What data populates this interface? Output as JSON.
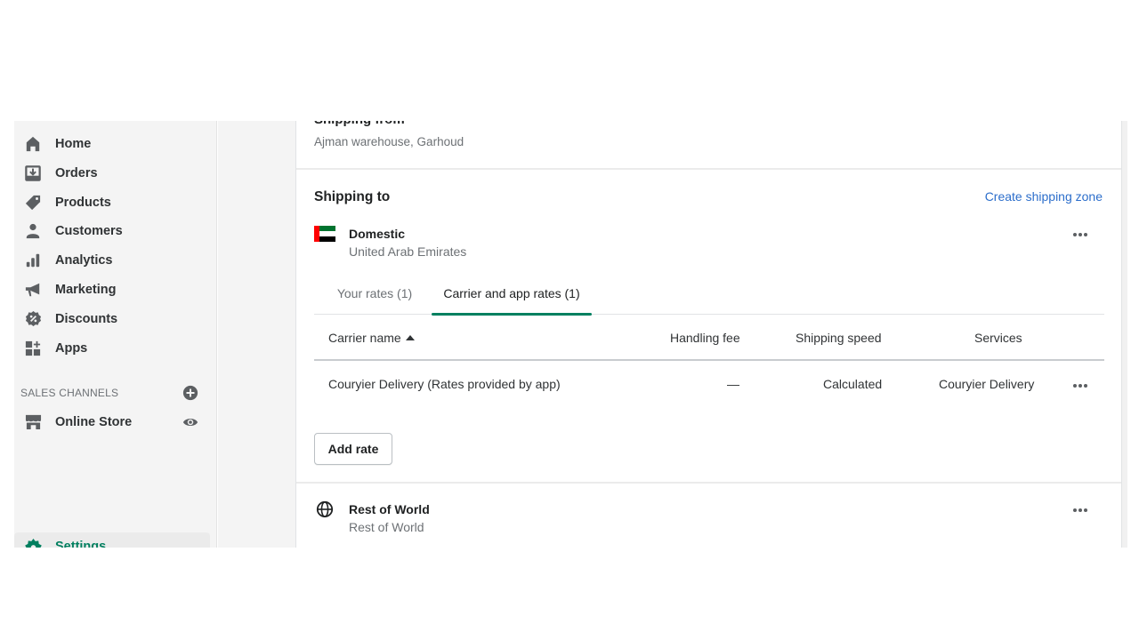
{
  "sidebar": {
    "items": [
      {
        "label": "Home",
        "icon": "home-icon"
      },
      {
        "label": "Orders",
        "icon": "orders-icon"
      },
      {
        "label": "Products",
        "icon": "tag-icon"
      },
      {
        "label": "Customers",
        "icon": "person-icon"
      },
      {
        "label": "Analytics",
        "icon": "bar-chart-icon"
      },
      {
        "label": "Marketing",
        "icon": "megaphone-icon"
      },
      {
        "label": "Discounts",
        "icon": "discount-icon"
      },
      {
        "label": "Apps",
        "icon": "apps-icon"
      }
    ],
    "sales_channels_header": "SALES CHANNELS",
    "sales_channels": [
      {
        "label": "Online Store",
        "icon": "store-icon"
      }
    ],
    "settings_label": "Settings"
  },
  "card": {
    "clipped_title": "Shipping from",
    "origin": "Ajman warehouse, Garhoud",
    "shipping_to_title": "Shipping to",
    "create_zone_link": "Create shipping zone",
    "zones": [
      {
        "name": "Domestic",
        "sub": "United Arab Emirates",
        "icon": "uae-flag-icon"
      },
      {
        "name": "Rest of World",
        "sub": "Rest of World",
        "icon": "globe-icon"
      }
    ],
    "tabs": [
      {
        "label": "Your rates (1)",
        "active": false
      },
      {
        "label": "Carrier and app rates (1)",
        "active": true
      }
    ],
    "table": {
      "headers": [
        "Carrier name",
        "Handling fee",
        "Shipping speed",
        "Services"
      ],
      "sort": "ascending",
      "rows": [
        {
          "carrier": "Couryier Delivery (Rates provided by app)",
          "handling_fee": "—",
          "speed": "Calculated",
          "services": "Couryier Delivery"
        }
      ]
    },
    "add_rate_label": "Add rate"
  },
  "colors": {
    "accent": "#008060",
    "link": "#2c6ecb"
  }
}
